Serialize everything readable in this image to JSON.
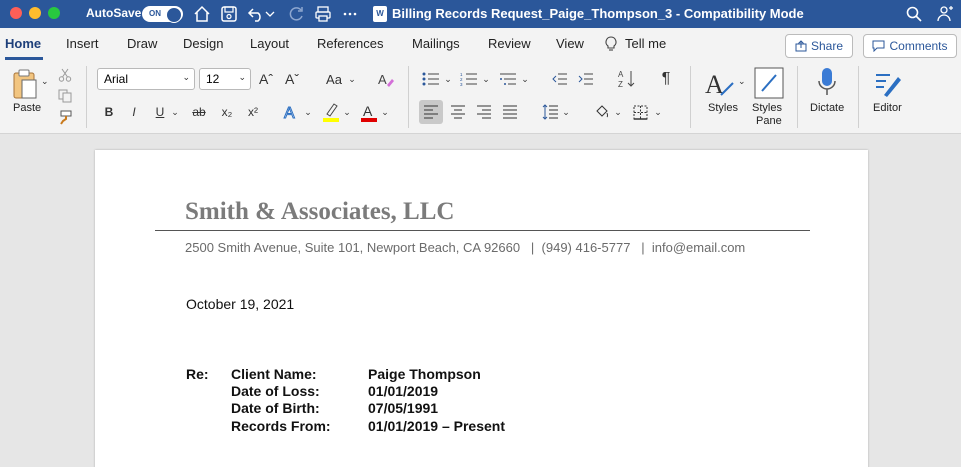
{
  "window": {
    "autosave_label": "AutoSave",
    "autosave_state": "ON",
    "title": "Billing Records Request_Paige_Thompson_3  -  Compatibility Mode",
    "doc_icon_letter": "W"
  },
  "ribbon_tabs": {
    "items": [
      "Home",
      "Insert",
      "Draw",
      "Design",
      "Layout",
      "References",
      "Mailings",
      "Review",
      "View"
    ],
    "active": "Home",
    "tell_me": "Tell me"
  },
  "actions": {
    "share": "Share",
    "comments": "Comments"
  },
  "toolbar": {
    "paste": "Paste",
    "font_name": "Arial",
    "font_size": "12",
    "grow_font": "Aˆ",
    "shrink_font": "Aˇ",
    "change_case": "Aa",
    "bold": "B",
    "italic": "I",
    "underline": "U",
    "strikethrough": "ab",
    "subscript": "x₂",
    "superscript": "x²",
    "styles": "Styles",
    "styles_pane_1": "Styles",
    "styles_pane_2": "Pane",
    "dictate": "Dictate",
    "editor": "Editor"
  },
  "colors": {
    "title_bar": "#2b579a",
    "highlight": "#ffff00",
    "font_color": "#e00000"
  },
  "document": {
    "firm_name": "Smith & Associates, LLC",
    "address": "2500 Smith Avenue, Suite 101, Newport Beach, CA 92660   |  (949) 416-5777   |  info@email.com",
    "date": "October 19, 2021",
    "re_label": "Re:",
    "fields": [
      {
        "label": "Client Name:",
        "value": "Paige Thompson"
      },
      {
        "label": "Date of Loss:",
        "value": "01/01/2019"
      },
      {
        "label": "Date of Birth:",
        "value": "07/05/1991"
      },
      {
        "label": "Records From:",
        "value": "01/01/2019 – Present"
      }
    ]
  }
}
